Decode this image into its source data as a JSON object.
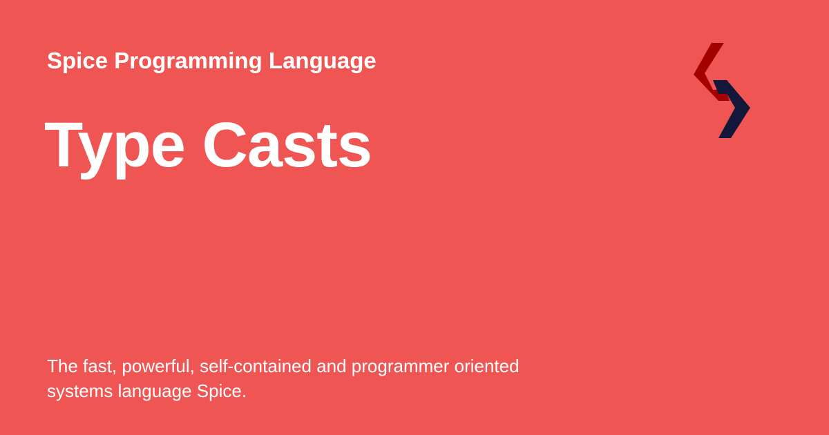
{
  "site": {
    "name": "Spice Programming Language"
  },
  "page": {
    "title": "Type Casts",
    "description": "The fast, powerful, self-contained and programmer oriented systems language Spice."
  },
  "logo": {
    "icon": "spice-logo-icon",
    "colors": {
      "red": "#A50000",
      "navy": "#13183A"
    }
  },
  "theme": {
    "background": "#EF5552",
    "text": "#FFFFFF"
  }
}
